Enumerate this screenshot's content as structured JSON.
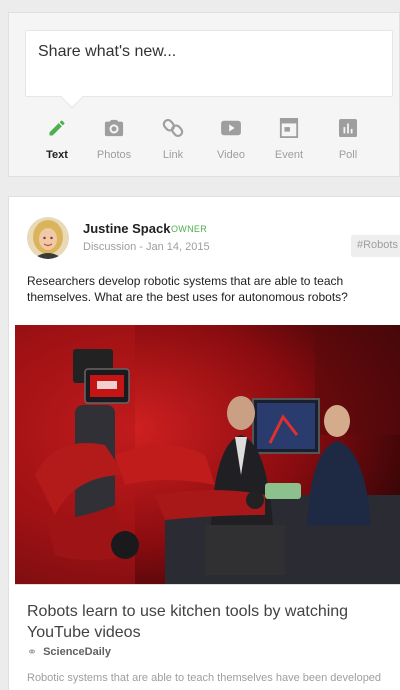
{
  "share": {
    "placeholder": "Share what's new...",
    "actions": [
      {
        "label": "Text",
        "icon": "pencil-icon",
        "active": true
      },
      {
        "label": "Photos",
        "icon": "camera-icon",
        "active": false
      },
      {
        "label": "Link",
        "icon": "link-icon",
        "active": false
      },
      {
        "label": "Video",
        "icon": "video-icon",
        "active": false
      },
      {
        "label": "Event",
        "icon": "event-icon",
        "active": false
      },
      {
        "label": "Poll",
        "icon": "poll-icon",
        "active": false
      }
    ]
  },
  "post": {
    "author": "Justine Spack",
    "role": "OWNER",
    "category": "Discussion",
    "date": "Jan 14, 2015",
    "meta_separator": " - ",
    "tag": "#Robots",
    "text": "Researchers develop robotic systems that are able to teach themselves. What are the best uses for autonomous robots?",
    "link": {
      "title": "Robots learn to use kitchen tools by watching YouTube videos",
      "source": "ScienceDaily",
      "snippet": "Robotic systems that are able to teach themselves have been developed"
    }
  },
  "colors": {
    "accent_green": "#4caf50",
    "icon_gray": "#9e9e9e",
    "page_bg": "#ececec"
  }
}
